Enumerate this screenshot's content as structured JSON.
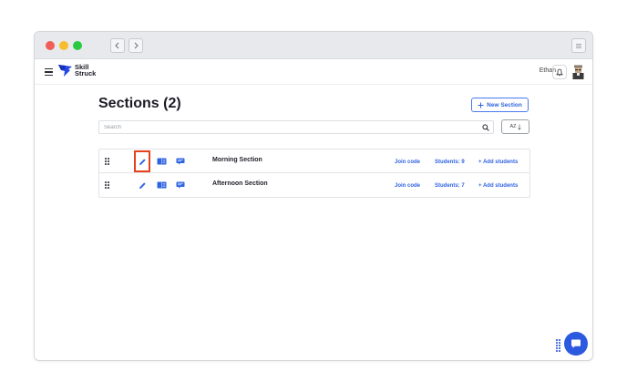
{
  "window": {
    "traffic_lights": [
      "#ef5f57",
      "#f6bd2f",
      "#29c940"
    ]
  },
  "app": {
    "logo_line1": "Skill",
    "logo_line2": "Struck",
    "user_name": "Ethan"
  },
  "page": {
    "title": "Sections (2)",
    "new_section_label": "New Section",
    "search_placeholder": "Search",
    "sort_label": "AZ"
  },
  "sections": [
    {
      "name": "Morning Section",
      "join_code_label": "Join code",
      "students_label": "Students: 9",
      "add_students_label": "+ Add students"
    },
    {
      "name": "Afternoon Section",
      "join_code_label": "Join code",
      "students_label": "Students: 7",
      "add_students_label": "+ Add students"
    }
  ],
  "colors": {
    "accent": "#2f63e0",
    "highlight": "#e5431b",
    "chat": "#2b59e0"
  },
  "icons": [
    "drag-handle-icon",
    "pencil-icon",
    "book-icon",
    "chat-board-icon",
    "search-icon",
    "bell-icon",
    "hamburger-icon",
    "chat-icon"
  ]
}
